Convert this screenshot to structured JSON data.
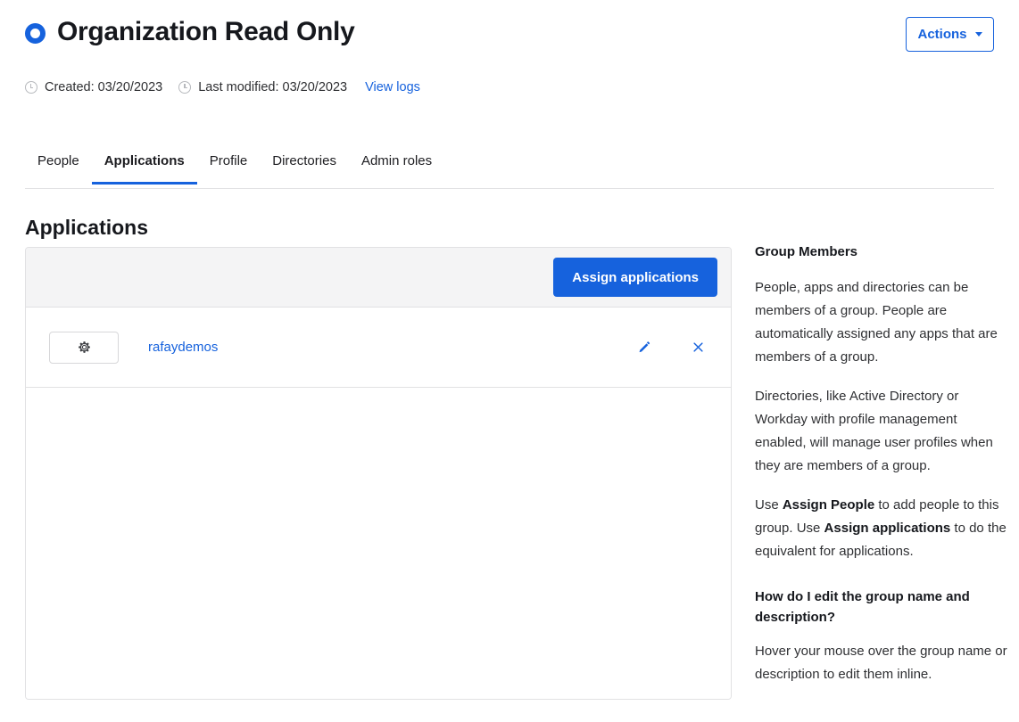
{
  "header": {
    "title": "Organization Read Only",
    "group_icon": "group-ring-icon",
    "created_label": "Created: 03/20/2023",
    "modified_label": "Last modified: 03/20/2023",
    "view_logs_label": "View logs",
    "actions_label": "Actions"
  },
  "tabs": [
    {
      "label": "People",
      "active": false
    },
    {
      "label": "Applications",
      "active": true
    },
    {
      "label": "Profile",
      "active": false
    },
    {
      "label": "Directories",
      "active": false
    },
    {
      "label": "Admin roles",
      "active": false
    }
  ],
  "main": {
    "section_title": "Applications",
    "assign_button_label": "Assign applications",
    "rows": [
      {
        "icon": "gear-icon",
        "name": "rafaydemos",
        "edit_icon": "pencil-icon",
        "remove_icon": "close-icon"
      }
    ]
  },
  "aside": {
    "heading": "Group Members",
    "p1": "People, apps and directories can be members of a group. People are automatically assigned any apps that are members of a group.",
    "p2": "Directories, like Active Directory or Workday with profile management enabled, will manage user profiles when they are members of a group.",
    "p3_part1": "Use ",
    "p3_bold1": "Assign People",
    "p3_part2": " to add people to this group. Use ",
    "p3_bold2": "Assign applications",
    "p3_part3": " to do the equivalent for applications.",
    "question": "How do I edit the group name and description?",
    "answer": "Hover your mouse over the group name or description to edit them inline."
  },
  "colors": {
    "accent_blue": "#1662dd",
    "link_blue": "#1662dd",
    "toolbar_gray": "#f4f4f5",
    "border_gray": "#e1e1e3",
    "text_dark": "#16181d"
  }
}
